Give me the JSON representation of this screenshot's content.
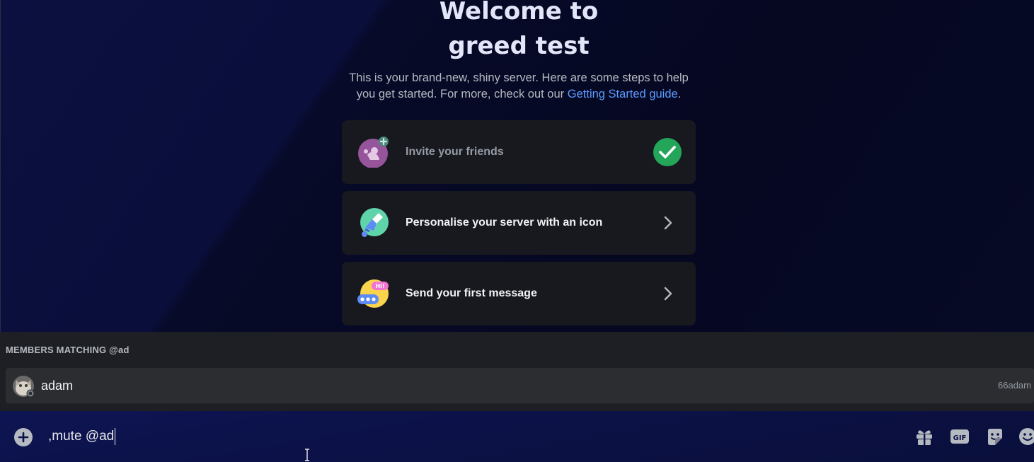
{
  "welcome": {
    "title_line1": "Welcome to",
    "title_line2": "greed test",
    "subtitle": "This is your brand-new, shiny server. Here are some steps to help you get started. For more, check out our",
    "guide_link": "Getting Started guide",
    "period": "."
  },
  "steps": [
    {
      "label": "Invite your friends",
      "status": "completed",
      "icon": "invite-friends-icon"
    },
    {
      "label": "Personalise your server with an icon",
      "status": "pending",
      "icon": "paintbrush-icon"
    },
    {
      "label": "Send your first message",
      "status": "pending",
      "icon": "speech-bubble-icon"
    }
  ],
  "mentions": {
    "header": "MEMBERS MATCHING @ad",
    "results": [
      {
        "display_name": "adam",
        "username": "66adam"
      }
    ]
  },
  "composer": {
    "text": ",mute @ad",
    "tools": [
      "gift-icon",
      "gif-icon",
      "sticker-icon",
      "emoji-icon"
    ],
    "gif_label": "GIF"
  },
  "colors": {
    "accent_link": "#5c9bff",
    "success": "#23a55a",
    "card_bg": "#18191f"
  }
}
